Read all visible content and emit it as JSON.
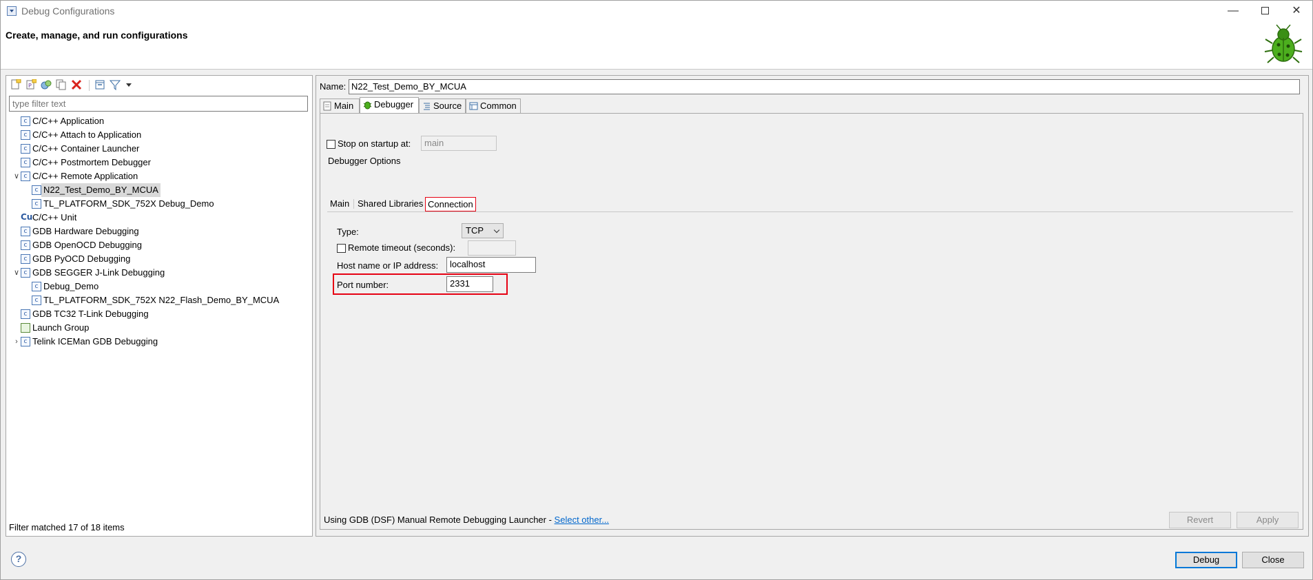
{
  "window": {
    "title": "Debug Configurations",
    "subtitle": "Create, manage, and run configurations"
  },
  "left": {
    "filter_placeholder": "type filter text",
    "filter_status": "Filter matched 17 of 18 items",
    "tree": [
      {
        "label": "C/C++ Application",
        "level": 0,
        "expand": "",
        "icon": "c"
      },
      {
        "label": "C/C++ Attach to Application",
        "level": 0,
        "expand": "",
        "icon": "c"
      },
      {
        "label": "C/C++ Container Launcher",
        "level": 0,
        "expand": "",
        "icon": "c"
      },
      {
        "label": "C/C++ Postmortem Debugger",
        "level": 0,
        "expand": "",
        "icon": "c"
      },
      {
        "label": "C/C++ Remote Application",
        "level": 0,
        "expand": "v",
        "icon": "c"
      },
      {
        "label": "N22_Test_Demo_BY_MCUA",
        "level": 1,
        "expand": "",
        "icon": "c",
        "selected": true
      },
      {
        "label": "TL_PLATFORM_SDK_752X Debug_Demo",
        "level": 1,
        "expand": "",
        "icon": "c"
      },
      {
        "label": "C/C++ Unit",
        "level": 0,
        "expand": "",
        "icon": "unit"
      },
      {
        "label": "GDB Hardware Debugging",
        "level": 0,
        "expand": "",
        "icon": "c"
      },
      {
        "label": "GDB OpenOCD Debugging",
        "level": 0,
        "expand": "",
        "icon": "c"
      },
      {
        "label": "GDB PyOCD Debugging",
        "level": 0,
        "expand": "",
        "icon": "c"
      },
      {
        "label": "GDB SEGGER J-Link Debugging",
        "level": 0,
        "expand": "v",
        "icon": "c"
      },
      {
        "label": "Debug_Demo",
        "level": 1,
        "expand": "",
        "icon": "c"
      },
      {
        "label": "TL_PLATFORM_SDK_752X N22_Flash_Demo_BY_MCUA",
        "level": 1,
        "expand": "",
        "icon": "c"
      },
      {
        "label": "GDB TC32 T-Link Debugging",
        "level": 0,
        "expand": "",
        "icon": "c"
      },
      {
        "label": "Launch Group",
        "level": 0,
        "expand": "",
        "icon": "launch"
      },
      {
        "label": "Telink ICEMan GDB Debugging",
        "level": 0,
        "expand": ">",
        "icon": "c"
      }
    ]
  },
  "right": {
    "name_label": "Name:",
    "name_value": "N22_Test_Demo_BY_MCUA",
    "tabs": [
      {
        "label": "Main",
        "active": false
      },
      {
        "label": "Debugger",
        "active": true
      },
      {
        "label": "Source",
        "active": false
      },
      {
        "label": "Common",
        "active": false
      }
    ],
    "stop_on_startup_label": "Stop on startup at:",
    "stop_on_startup_value": "main",
    "debugger_options_label": "Debugger Options",
    "subtabs": [
      {
        "label": "Main",
        "active": false
      },
      {
        "label": "Shared Libraries",
        "active": false
      },
      {
        "label": "Connection",
        "active": true
      }
    ],
    "type_label": "Type:",
    "type_value": "TCP",
    "remote_timeout_label": "Remote timeout (seconds):",
    "host_label": "Host name or IP address:",
    "host_value": "localhost",
    "port_label": "Port number:",
    "port_value": "2331",
    "launcher_text": "Using GDB (DSF) Manual Remote Debugging Launcher - ",
    "launcher_link": "Select other...",
    "revert_label": "Revert",
    "apply_label": "Apply"
  },
  "footer": {
    "help_symbol": "?",
    "debug_label": "Debug",
    "close_label": "Close"
  }
}
